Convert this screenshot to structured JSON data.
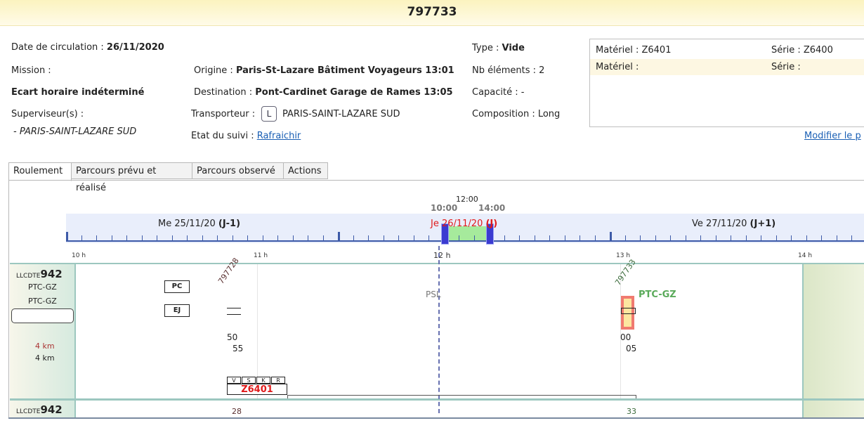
{
  "header": {
    "title": "797733"
  },
  "info": {
    "date_label": "Date de circulation : ",
    "date_value": "26/11/2020",
    "mission_label": "Mission :",
    "ecart": "Ecart horaire indéterminé",
    "superviseur_label": "Superviseur(s) :",
    "superviseur_value": "- PARIS-SAINT-LAZARE SUD",
    "origine_label": "Origine : ",
    "origine_value": "Paris-St-Lazare Bâtiment Voyageurs 13:01",
    "destination_label": "Destination : ",
    "destination_value": "Pont-Cardinet Garage de Rames 13:05",
    "transporteur_label": "Transporteur : ",
    "transporteur_badge": "L",
    "transporteur_value": "PARIS-SAINT-LAZARE SUD",
    "etat_label": "Etat du suivi : ",
    "etat_link": "Rafraichir",
    "type_label": "Type : ",
    "type_value": "Vide",
    "nb_elements": "Nb éléments : 2",
    "capacite": "Capacité : -",
    "composition": "Composition : Long"
  },
  "material": {
    "rows": [
      {
        "materiel": "Matériel : Z6401",
        "serie": "Série : Z6400"
      },
      {
        "materiel": "Matériel :",
        "serie": "Série :"
      }
    ],
    "modify_link": "Modifier le p",
    "row_colors": [
      "#ffffff",
      "#fdf7e2"
    ]
  },
  "tabs": [
    {
      "label": "Roulement",
      "active": true
    },
    {
      "label": "Parcours prévu et réalisé",
      "active": false
    },
    {
      "label": "Parcours observé",
      "active": false
    },
    {
      "label": "Actions",
      "active": false
    }
  ],
  "timeline": {
    "days": [
      {
        "date": "Me 25/11/20 ",
        "rel": "(J-1)"
      },
      {
        "date": "Je 26/11/20 ",
        "rel": "(J)"
      },
      {
        "date": "Ve 27/11/20 ",
        "rel": "(J+1)"
      }
    ],
    "sel_start": "10:00",
    "sel_mid": "12:00",
    "sel_end": "14:00",
    "hours": [
      "10 h",
      "11 h",
      "12 h",
      "13 h",
      "14 h"
    ]
  },
  "roulement": {
    "row1": {
      "prefix": "LLCDTE",
      "number": "942",
      "line1": "PTC-GZ",
      "line2": "PTC-GZ",
      "km1": "4 km",
      "km2": "4 km"
    },
    "row2": {
      "prefix": "LLCDTE",
      "number": "942"
    },
    "btn_pc": "PC",
    "btn_ej": "EJ",
    "train1": "797728",
    "train2": "797733",
    "station_psl": "PSL",
    "station_ptc": "PTC-GZ",
    "t1_a": "50",
    "t1_b": "55",
    "t2_a": "00",
    "t2_b": "05",
    "vskr": [
      "V",
      "S",
      "K",
      "R"
    ],
    "unit_code": "Z6401",
    "row2_t1": "28",
    "row2_t2": "33"
  },
  "colors": {
    "accent_red": "#e01a1a",
    "green": "#5aaa5a",
    "link": "#1a5fb4"
  }
}
